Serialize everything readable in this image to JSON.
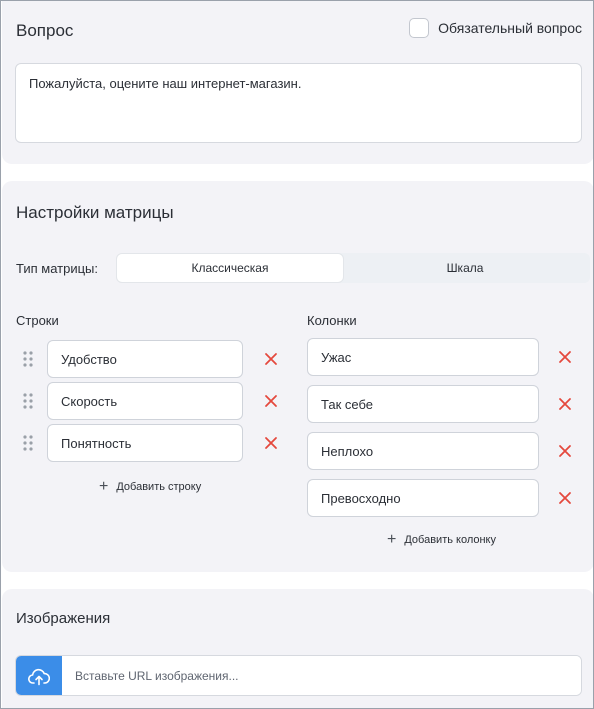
{
  "question": {
    "title": "Вопрос",
    "required_label": "Обязательный вопрос",
    "required_checked": false,
    "text": "Пожалуйста, оцените наш интернет-магазин."
  },
  "matrix": {
    "title": "Настройки матрицы",
    "type_label": "Тип матрицы:",
    "types": [
      "Классическая",
      "Шкала"
    ],
    "active_type": "Классическая",
    "rows_title": "Строки",
    "rows": [
      "Удобство",
      "Скорость",
      "Понятность"
    ],
    "add_row_label": "Добавить строку",
    "columns_title": "Колонки",
    "columns": [
      "Ужас",
      "Так себе",
      "Неплохо",
      "Превосходно"
    ],
    "add_column_label": "Добавить колонку"
  },
  "images": {
    "title": "Изображения",
    "url_placeholder": "Вставьте URL изображения..."
  },
  "colors": {
    "card_bg": "#f3f3f7",
    "accent": "#3b8de8",
    "delete": "#e5483d"
  },
  "icons": {
    "drag": "drag-handle-icon",
    "delete": "close-icon",
    "add": "plus-icon",
    "upload": "cloud-upload-icon"
  }
}
